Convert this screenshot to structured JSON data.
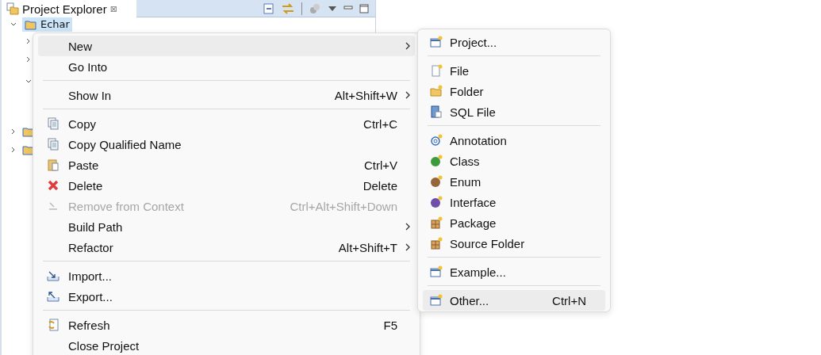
{
  "explorer": {
    "title": "Project Explorer",
    "close": "⊠",
    "tree": [
      {
        "label": "Echar",
        "expanded": true,
        "selected": true,
        "children": [
          {
            "expanded": false
          },
          {
            "expanded": false
          },
          {
            "expanded": true
          }
        ]
      },
      {
        "expanded": false
      },
      {
        "expanded": false
      }
    ]
  },
  "context_menu": [
    {
      "kind": "item",
      "label": "New",
      "submenu": true,
      "selected": true,
      "disabled": false
    },
    {
      "kind": "item",
      "label": "Go Into",
      "submenu": false,
      "selected": false,
      "disabled": false
    },
    {
      "kind": "separator"
    },
    {
      "kind": "item",
      "label": "Show In",
      "shortcut": "Alt+Shift+W",
      "submenu": true,
      "selected": false,
      "disabled": false
    },
    {
      "kind": "separator"
    },
    {
      "kind": "item",
      "label": "Copy",
      "shortcut": "Ctrl+C",
      "submenu": false,
      "selected": false,
      "disabled": false
    },
    {
      "kind": "item",
      "label": "Copy Qualified Name",
      "submenu": false,
      "selected": false,
      "disabled": false
    },
    {
      "kind": "item",
      "label": "Paste",
      "shortcut": "Ctrl+V",
      "submenu": false,
      "selected": false,
      "disabled": false
    },
    {
      "kind": "item",
      "label": "Delete",
      "shortcut": "Delete",
      "submenu": false,
      "selected": false,
      "disabled": false
    },
    {
      "kind": "item",
      "label": "Remove from Context",
      "shortcut": "Ctrl+Alt+Shift+Down",
      "submenu": false,
      "selected": false,
      "disabled": true
    },
    {
      "kind": "item",
      "label": "Build Path",
      "submenu": true,
      "selected": false,
      "disabled": false
    },
    {
      "kind": "item",
      "label": "Refactor",
      "shortcut": "Alt+Shift+T",
      "submenu": true,
      "selected": false,
      "disabled": false
    },
    {
      "kind": "separator"
    },
    {
      "kind": "item",
      "label": "Import...",
      "submenu": false,
      "selected": false,
      "disabled": false
    },
    {
      "kind": "item",
      "label": "Export...",
      "submenu": false,
      "selected": false,
      "disabled": false
    },
    {
      "kind": "separator"
    },
    {
      "kind": "item",
      "label": "Refresh",
      "shortcut": "F5",
      "submenu": false,
      "selected": false,
      "disabled": false
    },
    {
      "kind": "item",
      "label": "Close Project",
      "submenu": false,
      "selected": false,
      "disabled": false
    }
  ],
  "new_submenu": [
    {
      "kind": "item",
      "label": "Project...",
      "selected": false
    },
    {
      "kind": "separator"
    },
    {
      "kind": "item",
      "label": "File",
      "selected": false
    },
    {
      "kind": "item",
      "label": "Folder",
      "selected": false
    },
    {
      "kind": "item",
      "label": "SQL File",
      "selected": false
    },
    {
      "kind": "separator"
    },
    {
      "kind": "item",
      "label": "Annotation",
      "selected": false
    },
    {
      "kind": "item",
      "label": "Class",
      "selected": false
    },
    {
      "kind": "item",
      "label": "Enum",
      "selected": false
    },
    {
      "kind": "item",
      "label": "Interface",
      "selected": false
    },
    {
      "kind": "item",
      "label": "Package",
      "selected": false
    },
    {
      "kind": "item",
      "label": "Source Folder",
      "selected": false
    },
    {
      "kind": "separator"
    },
    {
      "kind": "item",
      "label": "Example...",
      "selected": false
    },
    {
      "kind": "separator"
    },
    {
      "kind": "item",
      "label": "Other...",
      "shortcut": "Ctrl+N",
      "selected": true
    }
  ]
}
